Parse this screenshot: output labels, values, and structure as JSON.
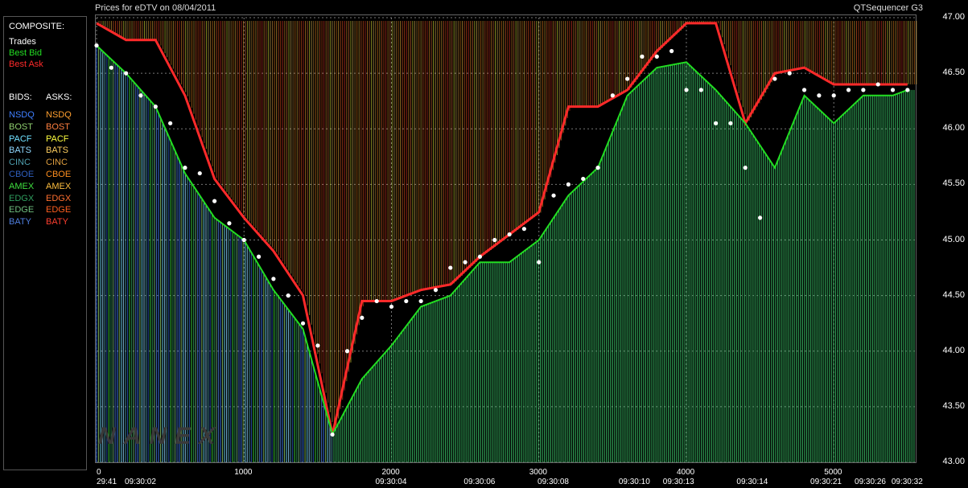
{
  "header": {
    "title": "Prices for  eDTV  on  08/04/2011",
    "product": "QTSequencer G3"
  },
  "legend": {
    "composite_label": "COMPOSITE:",
    "composite_items": [
      {
        "label": "Trades",
        "color": "#ffffff"
      },
      {
        "label": "Best Bid",
        "color": "#22dd22"
      },
      {
        "label": "Best Ask",
        "color": "#ff2a2a"
      }
    ],
    "bids_label": "BIDS:",
    "asks_label": "ASKS:",
    "bids": [
      {
        "label": "NSDQ",
        "color": "#3f7fff"
      },
      {
        "label": "BOST",
        "color": "#8fcf6f"
      },
      {
        "label": "PACF",
        "color": "#6fe0ff"
      },
      {
        "label": "BATS",
        "color": "#8fd8ff"
      },
      {
        "label": "CINC",
        "color": "#4fa0b0"
      },
      {
        "label": "CBOE",
        "color": "#2f5fbf"
      },
      {
        "label": "AMEX",
        "color": "#3fdf3f"
      },
      {
        "label": "EDGX",
        "color": "#2f9f5f"
      },
      {
        "label": "EDGE",
        "color": "#6fbf7f"
      },
      {
        "label": "BATY",
        "color": "#4f7fdf"
      }
    ],
    "asks": [
      {
        "label": "NSDQ",
        "color": "#ff9f2f"
      },
      {
        "label": "BOST",
        "color": "#ff7f3f"
      },
      {
        "label": "PACF",
        "color": "#ffff3f"
      },
      {
        "label": "BATS",
        "color": "#ffcf5f"
      },
      {
        "label": "CINC",
        "color": "#df9f3f"
      },
      {
        "label": "CBOE",
        "color": "#ff8f1f"
      },
      {
        "label": "AMEX",
        "color": "#ffbf3f"
      },
      {
        "label": "EDGX",
        "color": "#ff6f2f"
      },
      {
        "label": "EDGE",
        "color": "#ff5f1f"
      },
      {
        "label": "BATY",
        "color": "#ff3f2f"
      }
    ]
  },
  "watermark": "NANEX",
  "chart_data": {
    "type": "line",
    "title": "Prices for  eDTV  on  08/04/2011",
    "ylim": [
      43.0,
      47.0
    ],
    "xlim": [
      0,
      5550
    ],
    "y_ticks": [
      "47.00",
      "46.50",
      "46.00",
      "45.50",
      "45.00",
      "44.50",
      "44.00",
      "43.50",
      "43.00"
    ],
    "x_ticks_top": [
      {
        "x": 0,
        "label": "0"
      },
      {
        "x": 1000,
        "label": "1000"
      },
      {
        "x": 2000,
        "label": "2000"
      },
      {
        "x": 3000,
        "label": "3000"
      },
      {
        "x": 4000,
        "label": "4000"
      },
      {
        "x": 5000,
        "label": "5000"
      }
    ],
    "x_ticks_bottom": [
      {
        "x": 0,
        "label": "29:41"
      },
      {
        "x": 300,
        "label": "09:30:02"
      },
      {
        "x": 2000,
        "label": "09:30:04"
      },
      {
        "x": 2600,
        "label": "09:30:06"
      },
      {
        "x": 3100,
        "label": "09:30:08"
      },
      {
        "x": 3650,
        "label": "09:30:10"
      },
      {
        "x": 3950,
        "label": "09:30:13"
      },
      {
        "x": 4450,
        "label": "09:30:14"
      },
      {
        "x": 4950,
        "label": "09:30:21"
      },
      {
        "x": 5250,
        "label": "09:30:26"
      },
      {
        "x": 5500,
        "label": "09:30:32"
      }
    ],
    "grid": true,
    "series": [
      {
        "name": "Trades",
        "color": "#ffffff",
        "x": [
          0,
          100,
          200,
          300,
          400,
          500,
          600,
          700,
          800,
          900,
          1000,
          1100,
          1200,
          1300,
          1400,
          1500,
          1600,
          1700,
          1800,
          1900,
          2000,
          2100,
          2200,
          2300,
          2400,
          2500,
          2600,
          2700,
          2800,
          2900,
          3000,
          3100,
          3200,
          3300,
          3400,
          3500,
          3600,
          3700,
          3800,
          3900,
          4000,
          4100,
          4200,
          4300,
          4400,
          4500,
          4600,
          4700,
          4800,
          4900,
          5000,
          5100,
          5200,
          5300,
          5400,
          5500
        ],
        "y": [
          46.75,
          46.55,
          46.5,
          46.3,
          46.2,
          46.05,
          45.65,
          45.6,
          45.35,
          45.15,
          45.0,
          44.85,
          44.65,
          44.5,
          44.25,
          44.05,
          43.25,
          44.0,
          44.3,
          44.45,
          44.4,
          44.45,
          44.45,
          44.55,
          44.75,
          44.8,
          44.85,
          45.0,
          45.05,
          45.1,
          44.8,
          45.4,
          45.5,
          45.55,
          45.65,
          46.3,
          46.45,
          46.65,
          46.65,
          46.7,
          46.35,
          46.35,
          46.05,
          46.05,
          45.65,
          45.2,
          46.45,
          46.5,
          46.35,
          46.3,
          46.3,
          46.35,
          46.35,
          46.4,
          46.35,
          46.35
        ]
      },
      {
        "name": "Best Bid",
        "color": "#22dd22",
        "x": [
          0,
          200,
          400,
          600,
          800,
          1000,
          1200,
          1400,
          1600,
          1800,
          2000,
          2200,
          2400,
          2600,
          2800,
          3000,
          3200,
          3400,
          3600,
          3800,
          4000,
          4200,
          4400,
          4600,
          4800,
          5000,
          5200,
          5400,
          5500
        ],
        "y": [
          46.75,
          46.5,
          46.2,
          45.6,
          45.2,
          45.0,
          44.55,
          44.2,
          43.25,
          43.75,
          44.05,
          44.4,
          44.5,
          44.8,
          44.8,
          45.0,
          45.4,
          45.65,
          46.3,
          46.55,
          46.6,
          46.35,
          46.05,
          45.65,
          46.3,
          46.05,
          46.3,
          46.3,
          46.35
        ]
      },
      {
        "name": "Best Ask",
        "color": "#ff2a2a",
        "x": [
          0,
          200,
          400,
          600,
          800,
          1000,
          1200,
          1400,
          1600,
          1800,
          2000,
          2200,
          2400,
          2600,
          2800,
          3000,
          3200,
          3400,
          3600,
          3800,
          4000,
          4200,
          4400,
          4600,
          4800,
          5000,
          5200,
          5400,
          5500
        ],
        "y": [
          46.95,
          46.8,
          46.8,
          46.3,
          45.55,
          45.2,
          44.9,
          44.5,
          43.25,
          44.45,
          44.45,
          44.55,
          44.6,
          44.85,
          45.05,
          45.25,
          46.2,
          46.2,
          46.35,
          46.7,
          46.95,
          46.95,
          46.05,
          46.5,
          46.55,
          46.4,
          46.4,
          46.4,
          46.4
        ]
      }
    ]
  }
}
